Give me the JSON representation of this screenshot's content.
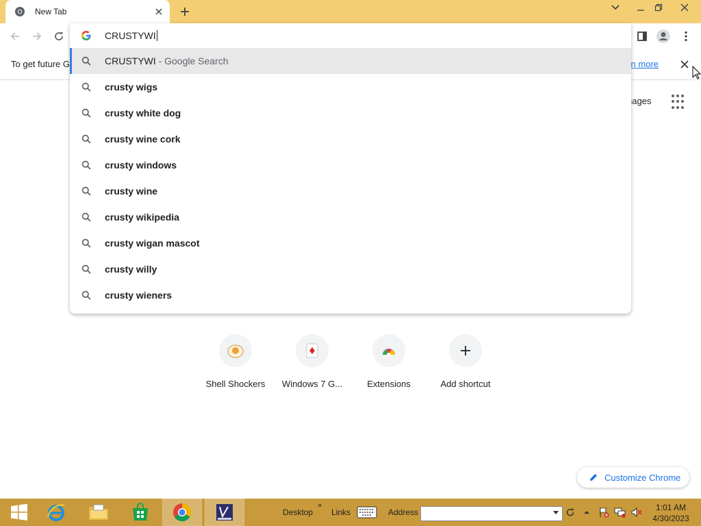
{
  "browser": {
    "tab_title": "New Tab",
    "omnibox_value": "CRUSTYWI"
  },
  "info_bar": {
    "text": "To get future G",
    "learn_more": "arn more"
  },
  "page": {
    "images_link": "nages"
  },
  "suggestions": [
    {
      "text": "CRUSTYWI",
      "suffix": "- Google Search",
      "selected": true
    },
    {
      "text": "crusty wigs"
    },
    {
      "text": "crusty white dog"
    },
    {
      "text": "crusty wine cork"
    },
    {
      "text": "crusty windows"
    },
    {
      "text": "crusty wine"
    },
    {
      "text": "crusty wikipedia"
    },
    {
      "text": "crusty wigan mascot"
    },
    {
      "text": "crusty willy"
    },
    {
      "text": "crusty wieners"
    }
  ],
  "shortcuts": [
    {
      "label": "Shell Shockers",
      "icon": "egg-icon"
    },
    {
      "label": "Windows 7 G...",
      "icon": "solitaire-card-icon"
    },
    {
      "label": "Extensions",
      "icon": "chrome-extensions-icon"
    },
    {
      "label": "Add shortcut",
      "icon": "plus-icon"
    }
  ],
  "customize_label": "Customize Chrome",
  "taskbar": {
    "desktop": "Desktop",
    "links": "Links",
    "address": "Address",
    "time": "1:01 AM",
    "date": "4/30/2023"
  },
  "colors": {
    "tabstrip": "#f3ce73",
    "taskbar": "#c99a3b",
    "accent": "#1a73e8"
  }
}
